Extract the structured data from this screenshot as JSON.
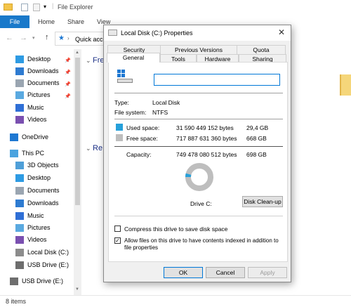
{
  "explorer": {
    "title": "File Explorer",
    "ribbon_tabs": [
      "File",
      "Home",
      "Share",
      "View"
    ],
    "address": "Quick acce",
    "headings": {
      "frequent": "Fre",
      "recent": "Re"
    },
    "nav": [
      {
        "label": "Desktop",
        "icon": "desktop-icon",
        "pinned": true
      },
      {
        "label": "Downloads",
        "icon": "downloads-icon",
        "pinned": true
      },
      {
        "label": "Documents",
        "icon": "documents-icon",
        "pinned": true
      },
      {
        "label": "Pictures",
        "icon": "pictures-icon",
        "pinned": true
      },
      {
        "label": "Music",
        "icon": "music-icon",
        "pinned": false
      },
      {
        "label": "Videos",
        "icon": "videos-icon",
        "pinned": false
      },
      {
        "label": "OneDrive",
        "icon": "onedrive-icon",
        "pinned": false
      },
      {
        "label": "This PC",
        "icon": "this-pc-icon",
        "pinned": false
      },
      {
        "label": "3D Objects",
        "icon": "3d-objects-icon",
        "pinned": false
      },
      {
        "label": "Desktop",
        "icon": "desktop-icon",
        "pinned": false
      },
      {
        "label": "Documents",
        "icon": "documents-icon",
        "pinned": false
      },
      {
        "label": "Downloads",
        "icon": "downloads-icon",
        "pinned": false
      },
      {
        "label": "Music",
        "icon": "music-icon",
        "pinned": false
      },
      {
        "label": "Pictures",
        "icon": "pictures-icon",
        "pinned": false
      },
      {
        "label": "Videos",
        "icon": "videos-icon",
        "pinned": false
      },
      {
        "label": "Local Disk (C:)",
        "icon": "local-disk-icon",
        "pinned": false
      },
      {
        "label": "USB Drive (E:)",
        "icon": "usb-drive-icon",
        "pinned": false
      },
      {
        "label": "USB Drive (E:)",
        "icon": "usb-drive-icon",
        "pinned": false
      }
    ],
    "status": "8 items"
  },
  "dialog": {
    "title": "Local Disk (C:) Properties",
    "tabs_row1": [
      "Security",
      "Previous Versions",
      "Quota"
    ],
    "tabs_row2": [
      "General",
      "Tools",
      "Hardware",
      "Sharing"
    ],
    "name_value": "",
    "type_label": "Type:",
    "type_value": "Local Disk",
    "fs_label": "File system:",
    "fs_value": "NTFS",
    "used_label": "Used space:",
    "used_bytes": "31 590 449 152 bytes",
    "used_gb": "29,4 GB",
    "free_label": "Free space:",
    "free_bytes": "717 887 631 360 bytes",
    "free_gb": "668 GB",
    "cap_label": "Capacity:",
    "cap_bytes": "749 478 080 512 bytes",
    "cap_gb": "698 GB",
    "used_fraction": 0.042,
    "drive_label": "Drive C:",
    "cleanup_label": "Disk Clean-up",
    "compress_label": "Compress this drive to save disk space",
    "compress_checked": false,
    "index_label_1": "Allow files on this drive to have contents indexed in addition to",
    "index_label_2": "file properties",
    "index_checked": true,
    "ok_label": "OK",
    "cancel_label": "Cancel",
    "apply_label": "Apply",
    "colors": {
      "used": "#26a0da",
      "free": "#bebebe",
      "accent": "#0078d7"
    }
  }
}
